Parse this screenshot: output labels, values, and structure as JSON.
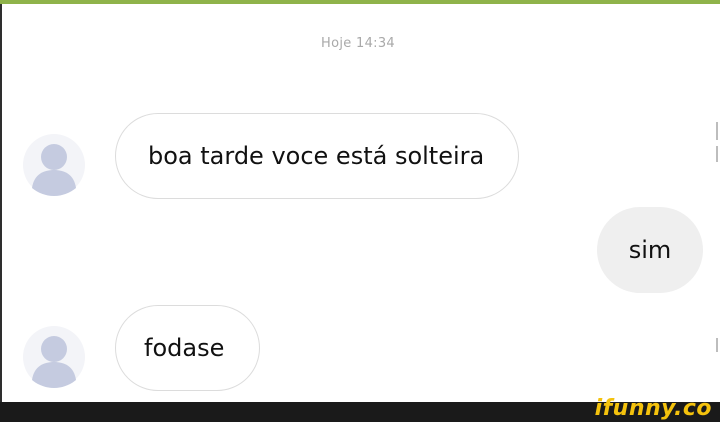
{
  "chat": {
    "timestamp": "Hoje 14:34",
    "messages": [
      {
        "direction": "incoming",
        "text": "boa tarde voce está solteira"
      },
      {
        "direction": "outgoing",
        "text": "sim"
      },
      {
        "direction": "incoming",
        "text": "fodase"
      }
    ]
  },
  "watermark": {
    "text": "ifunny.co"
  },
  "colors": {
    "top_accent": "#8fb34a",
    "avatar_fill": "#c5cbe0",
    "outgoing_bubble": "#efefef",
    "watermark": "#f4c20d"
  },
  "icons": {
    "avatar": "default-user-avatar-icon"
  }
}
